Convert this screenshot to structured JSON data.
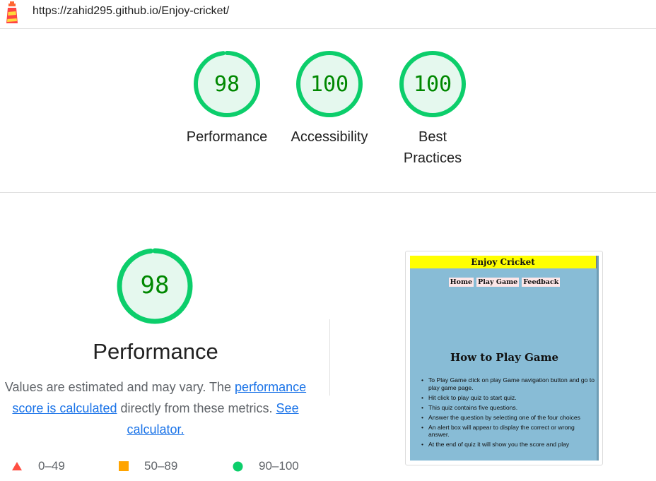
{
  "topbar": {
    "url": "https://zahid295.github.io/Enjoy-cricket/",
    "logo_icon": "lighthouse-icon"
  },
  "colors": {
    "pass": "#0cce6b",
    "pass_text": "#008800",
    "pass_fill": "#e5f8ee",
    "average": "#ffa400",
    "fail": "#ff4e42",
    "link": "#1a73e8"
  },
  "gauges": [
    {
      "score": "98",
      "label": "Performance"
    },
    {
      "score": "100",
      "label": "Accessibility"
    },
    {
      "score": "100",
      "label": "Best Practices"
    }
  ],
  "performance": {
    "score": "98",
    "title": "Performance",
    "desc_prefix": "Values are estimated and may vary. The ",
    "desc_link1": "performance score is calculated",
    "desc_middle": " directly from these metrics. ",
    "desc_link2": "See calculator."
  },
  "legend": [
    {
      "icon": "triangle-icon",
      "range": "0–49"
    },
    {
      "icon": "square-icon",
      "range": "50–89"
    },
    {
      "icon": "circle-icon",
      "range": "90–100"
    }
  ],
  "thumbnail": {
    "site_title": "Enjoy Cricket",
    "nav": [
      "Home",
      "Play Game",
      "Feedback"
    ],
    "heading": "How to Play Game",
    "steps": [
      "To Play Game click on play Game navigation button and go to play game page.",
      "Hit click to play quiz to start quiz.",
      "This quiz contains five questions.",
      "Answer the question by selecting one of the four choices",
      "An alert box will appear to display the correct or wrong answer.",
      "At the end of quiz it will show you the score and play"
    ]
  }
}
